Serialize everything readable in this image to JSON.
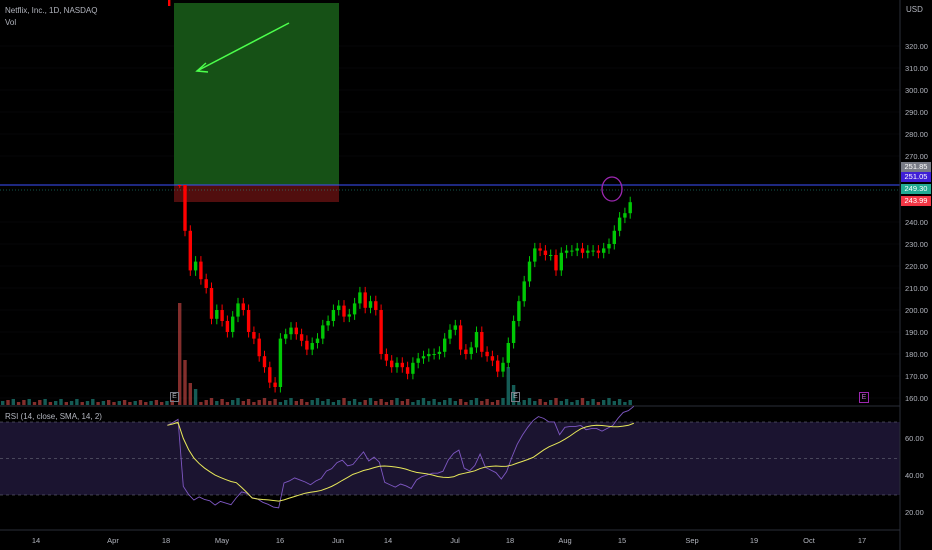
{
  "header": {
    "symbol_title": "Netflix, Inc., 1D, NASDAQ",
    "volume_label": "Vol",
    "currency": "USD"
  },
  "rsi_panel": {
    "label": "RSI (14, close, SMA, 14, 2)",
    "levels": [
      70,
      50,
      30
    ],
    "ticks": [
      "60.00",
      "40.00",
      "20.00"
    ]
  },
  "price_axis": {
    "ticks": [
      "320.00",
      "310.00",
      "300.00",
      "290.00",
      "280.00",
      "270.00",
      "240.00",
      "230.00",
      "220.00",
      "210.00",
      "200.00",
      "190.00",
      "180.00",
      "170.00",
      "160.00"
    ]
  },
  "price_tags": [
    {
      "value": "251.85",
      "color": "#787b86"
    },
    {
      "value": "251.05",
      "color": "#2962ff"
    },
    {
      "value": "249.30",
      "color": "#22ab94"
    },
    {
      "value": "243.99",
      "color": "#f23645"
    }
  ],
  "time_axis": {
    "labels": [
      "14",
      "Apr",
      "18",
      "May",
      "16",
      "Jun",
      "14",
      "Jul",
      "18",
      "Aug",
      "15",
      "Sep",
      "19",
      "Oct",
      "17"
    ]
  },
  "earnings_markers": [
    "E",
    "E",
    "E"
  ],
  "colors": {
    "up": "#00c805",
    "down": "#ff0000",
    "vol_up": "#26a69a",
    "vol_down": "#ef5350",
    "rsi_line": "#7e57c2",
    "rsi_sma": "#e8e85a",
    "box_green": "#1b5e20",
    "box_red": "#5c0b0b",
    "resistance": "#2962ff",
    "arrow": "#4cff4c",
    "circle": "#9c27b0"
  },
  "chart_data": {
    "type": "candlestick",
    "title": "Netflix, Inc., 1D, NASDAQ",
    "y_axis": {
      "ylim": [
        152,
        326
      ],
      "unit": "USD"
    },
    "close_series": [
      341,
      258,
      236,
      218,
      222,
      214,
      210,
      196,
      200,
      195,
      190,
      197,
      203,
      200,
      190,
      187,
      179,
      174,
      167,
      165,
      187,
      189,
      192,
      189,
      186,
      182,
      185,
      187,
      193,
      195,
      200,
      202,
      197,
      198,
      203,
      208,
      201,
      204,
      200,
      180,
      177,
      174,
      176,
      174,
      171,
      176,
      178,
      179,
      180,
      180,
      181,
      187,
      191,
      193,
      182,
      180,
      183,
      190,
      181,
      179,
      177,
      172,
      176,
      185,
      195,
      204,
      213,
      222,
      228,
      227,
      225,
      225,
      218,
      226,
      227,
      227,
      228,
      226,
      227,
      227,
      226,
      228,
      230,
      236,
      242,
      244,
      249
    ],
    "annotations": {
      "resistance_level": 251.05,
      "last_close": 249.3,
      "reference_levels": [
        251.85,
        243.99
      ]
    }
  }
}
